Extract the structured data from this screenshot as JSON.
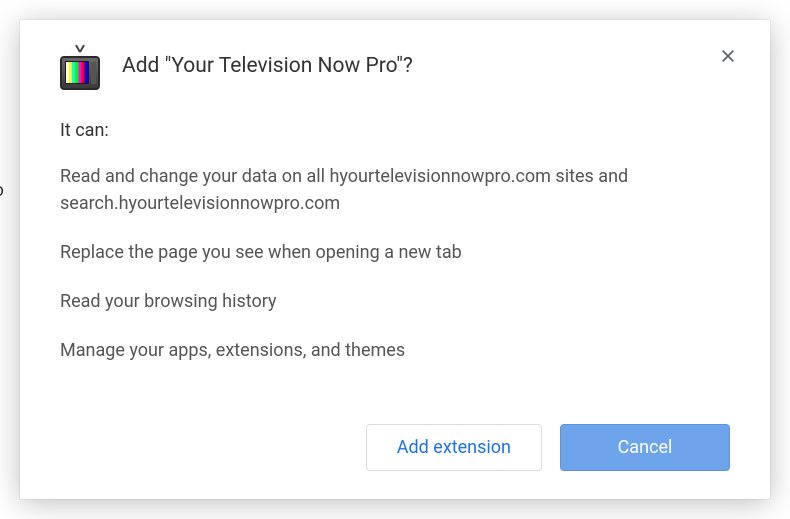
{
  "dialog": {
    "title": "Add \"Your Television Now Pro\"?",
    "intro": "It can:",
    "permissions": [
      "Read and change your data on all hyourtelevisionnowpro.com sites and search.hyourtelevisionnowpro.com",
      "Replace the page you see when opening a new tab",
      "Read your browsing history",
      "Manage your apps, extensions, and themes"
    ],
    "buttons": {
      "add": "Add extension",
      "cancel": "Cancel"
    }
  }
}
